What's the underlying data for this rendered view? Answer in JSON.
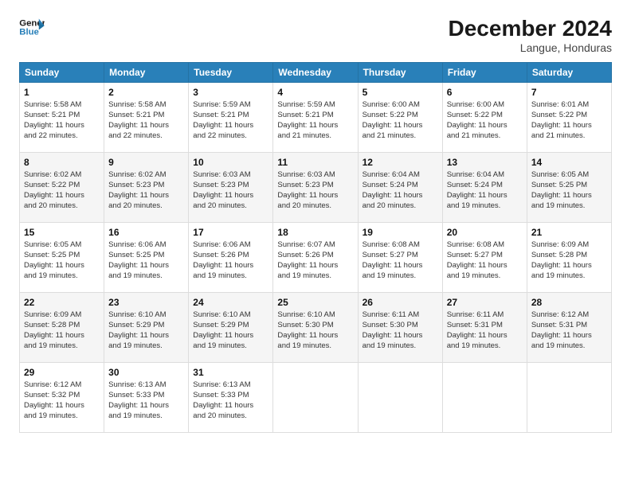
{
  "header": {
    "logo_line1": "General",
    "logo_line2": "Blue",
    "main_title": "December 2024",
    "subtitle": "Langue, Honduras"
  },
  "days_of_week": [
    "Sunday",
    "Monday",
    "Tuesday",
    "Wednesday",
    "Thursday",
    "Friday",
    "Saturday"
  ],
  "weeks": [
    [
      {
        "day": "1",
        "lines": [
          "Sunrise: 5:58 AM",
          "Sunset: 5:21 PM",
          "Daylight: 11 hours",
          "and 22 minutes."
        ]
      },
      {
        "day": "2",
        "lines": [
          "Sunrise: 5:58 AM",
          "Sunset: 5:21 PM",
          "Daylight: 11 hours",
          "and 22 minutes."
        ]
      },
      {
        "day": "3",
        "lines": [
          "Sunrise: 5:59 AM",
          "Sunset: 5:21 PM",
          "Daylight: 11 hours",
          "and 22 minutes."
        ]
      },
      {
        "day": "4",
        "lines": [
          "Sunrise: 5:59 AM",
          "Sunset: 5:21 PM",
          "Daylight: 11 hours",
          "and 21 minutes."
        ]
      },
      {
        "day": "5",
        "lines": [
          "Sunrise: 6:00 AM",
          "Sunset: 5:22 PM",
          "Daylight: 11 hours",
          "and 21 minutes."
        ]
      },
      {
        "day": "6",
        "lines": [
          "Sunrise: 6:00 AM",
          "Sunset: 5:22 PM",
          "Daylight: 11 hours",
          "and 21 minutes."
        ]
      },
      {
        "day": "7",
        "lines": [
          "Sunrise: 6:01 AM",
          "Sunset: 5:22 PM",
          "Daylight: 11 hours",
          "and 21 minutes."
        ]
      }
    ],
    [
      {
        "day": "8",
        "lines": [
          "Sunrise: 6:02 AM",
          "Sunset: 5:22 PM",
          "Daylight: 11 hours",
          "and 20 minutes."
        ]
      },
      {
        "day": "9",
        "lines": [
          "Sunrise: 6:02 AM",
          "Sunset: 5:23 PM",
          "Daylight: 11 hours",
          "and 20 minutes."
        ]
      },
      {
        "day": "10",
        "lines": [
          "Sunrise: 6:03 AM",
          "Sunset: 5:23 PM",
          "Daylight: 11 hours",
          "and 20 minutes."
        ]
      },
      {
        "day": "11",
        "lines": [
          "Sunrise: 6:03 AM",
          "Sunset: 5:23 PM",
          "Daylight: 11 hours",
          "and 20 minutes."
        ]
      },
      {
        "day": "12",
        "lines": [
          "Sunrise: 6:04 AM",
          "Sunset: 5:24 PM",
          "Daylight: 11 hours",
          "and 20 minutes."
        ]
      },
      {
        "day": "13",
        "lines": [
          "Sunrise: 6:04 AM",
          "Sunset: 5:24 PM",
          "Daylight: 11 hours",
          "and 19 minutes."
        ]
      },
      {
        "day": "14",
        "lines": [
          "Sunrise: 6:05 AM",
          "Sunset: 5:25 PM",
          "Daylight: 11 hours",
          "and 19 minutes."
        ]
      }
    ],
    [
      {
        "day": "15",
        "lines": [
          "Sunrise: 6:05 AM",
          "Sunset: 5:25 PM",
          "Daylight: 11 hours",
          "and 19 minutes."
        ]
      },
      {
        "day": "16",
        "lines": [
          "Sunrise: 6:06 AM",
          "Sunset: 5:25 PM",
          "Daylight: 11 hours",
          "and 19 minutes."
        ]
      },
      {
        "day": "17",
        "lines": [
          "Sunrise: 6:06 AM",
          "Sunset: 5:26 PM",
          "Daylight: 11 hours",
          "and 19 minutes."
        ]
      },
      {
        "day": "18",
        "lines": [
          "Sunrise: 6:07 AM",
          "Sunset: 5:26 PM",
          "Daylight: 11 hours",
          "and 19 minutes."
        ]
      },
      {
        "day": "19",
        "lines": [
          "Sunrise: 6:08 AM",
          "Sunset: 5:27 PM",
          "Daylight: 11 hours",
          "and 19 minutes."
        ]
      },
      {
        "day": "20",
        "lines": [
          "Sunrise: 6:08 AM",
          "Sunset: 5:27 PM",
          "Daylight: 11 hours",
          "and 19 minutes."
        ]
      },
      {
        "day": "21",
        "lines": [
          "Sunrise: 6:09 AM",
          "Sunset: 5:28 PM",
          "Daylight: 11 hours",
          "and 19 minutes."
        ]
      }
    ],
    [
      {
        "day": "22",
        "lines": [
          "Sunrise: 6:09 AM",
          "Sunset: 5:28 PM",
          "Daylight: 11 hours",
          "and 19 minutes."
        ]
      },
      {
        "day": "23",
        "lines": [
          "Sunrise: 6:10 AM",
          "Sunset: 5:29 PM",
          "Daylight: 11 hours",
          "and 19 minutes."
        ]
      },
      {
        "day": "24",
        "lines": [
          "Sunrise: 6:10 AM",
          "Sunset: 5:29 PM",
          "Daylight: 11 hours",
          "and 19 minutes."
        ]
      },
      {
        "day": "25",
        "lines": [
          "Sunrise: 6:10 AM",
          "Sunset: 5:30 PM",
          "Daylight: 11 hours",
          "and 19 minutes."
        ]
      },
      {
        "day": "26",
        "lines": [
          "Sunrise: 6:11 AM",
          "Sunset: 5:30 PM",
          "Daylight: 11 hours",
          "and 19 minutes."
        ]
      },
      {
        "day": "27",
        "lines": [
          "Sunrise: 6:11 AM",
          "Sunset: 5:31 PM",
          "Daylight: 11 hours",
          "and 19 minutes."
        ]
      },
      {
        "day": "28",
        "lines": [
          "Sunrise: 6:12 AM",
          "Sunset: 5:31 PM",
          "Daylight: 11 hours",
          "and 19 minutes."
        ]
      }
    ],
    [
      {
        "day": "29",
        "lines": [
          "Sunrise: 6:12 AM",
          "Sunset: 5:32 PM",
          "Daylight: 11 hours",
          "and 19 minutes."
        ]
      },
      {
        "day": "30",
        "lines": [
          "Sunrise: 6:13 AM",
          "Sunset: 5:33 PM",
          "Daylight: 11 hours",
          "and 19 minutes."
        ]
      },
      {
        "day": "31",
        "lines": [
          "Sunrise: 6:13 AM",
          "Sunset: 5:33 PM",
          "Daylight: 11 hours",
          "and 20 minutes."
        ]
      },
      {
        "day": "",
        "lines": []
      },
      {
        "day": "",
        "lines": []
      },
      {
        "day": "",
        "lines": []
      },
      {
        "day": "",
        "lines": []
      }
    ]
  ]
}
